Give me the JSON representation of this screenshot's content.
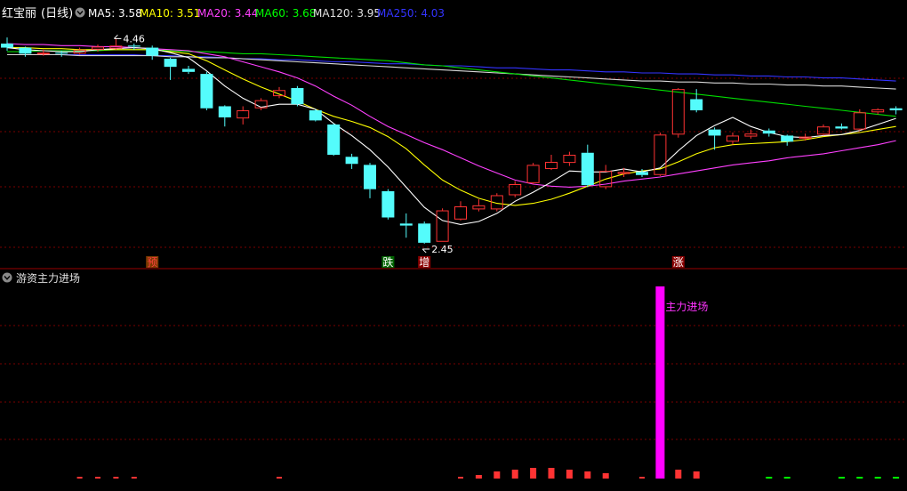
{
  "header": {
    "stock_name": "红宝丽",
    "period": "(日线)",
    "ma_items": [
      {
        "label": "MA5: 3.58",
        "color": "#ffffff"
      },
      {
        "label": "MA10: 3.51",
        "color": "#ffff00"
      },
      {
        "label": "MA20: 3.44",
        "color": "#ff40ff"
      },
      {
        "label": "MA60: 3.68",
        "color": "#00ff00"
      },
      {
        "label": "MA120: 3.95",
        "color": "#e0e0e0"
      },
      {
        "label": "MA250: 4.03",
        "color": "#3333ff"
      }
    ]
  },
  "main_panel": {
    "high_label": "4.46",
    "low_label": "2.45",
    "signals": [
      {
        "text": "预",
        "index": 8,
        "color": "#ff4040",
        "bg": "#7a3a00"
      },
      {
        "text": "跌",
        "index": 21,
        "color": "#ffffff",
        "bg": "#006400"
      },
      {
        "text": "增",
        "index": 23,
        "color": "#ffffff",
        "bg": "#8b0000"
      },
      {
        "text": "涨",
        "index": 37,
        "color": "#ffffff",
        "bg": "#8b0000"
      }
    ]
  },
  "sub_panel": {
    "title": "游资主力进场",
    "annotation": "主力进场",
    "annotation_color": "#ff33ff"
  },
  "colors": {
    "up": "#ff3333",
    "down": "#54fcfc",
    "grid": "#7a0000",
    "pink_bar": "#ff00ff",
    "green_tick": "#00ff00"
  },
  "chart_data": {
    "type": "candlestick",
    "price_range": [
      2.35,
      4.62
    ],
    "candles": [
      [
        4.4,
        4.36,
        4.46,
        4.33
      ],
      [
        4.36,
        4.3,
        4.37,
        4.27
      ],
      [
        4.3,
        4.31,
        4.34,
        4.28
      ],
      [
        4.31,
        4.3,
        4.33,
        4.27
      ],
      [
        4.3,
        4.34,
        4.36,
        4.29
      ],
      [
        4.34,
        4.37,
        4.39,
        4.32
      ],
      [
        4.35,
        4.38,
        4.45,
        4.34
      ],
      [
        4.38,
        4.37,
        4.4,
        4.34
      ],
      [
        4.36,
        4.28,
        4.38,
        4.24
      ],
      [
        4.25,
        4.17,
        4.26,
        4.04
      ],
      [
        4.15,
        4.12,
        4.18,
        4.1
      ],
      [
        4.1,
        3.76,
        4.12,
        3.74
      ],
      [
        3.78,
        3.67,
        3.79,
        3.58
      ],
      [
        3.66,
        3.74,
        3.78,
        3.6
      ],
      [
        3.76,
        3.84,
        3.86,
        3.74
      ],
      [
        3.88,
        3.94,
        3.97,
        3.86
      ],
      [
        3.96,
        3.8,
        3.98,
        3.78
      ],
      [
        3.74,
        3.64,
        3.75,
        3.63
      ],
      [
        3.6,
        3.3,
        3.61,
        3.29
      ],
      [
        3.28,
        3.21,
        3.31,
        3.16
      ],
      [
        3.2,
        2.96,
        3.22,
        2.87
      ],
      [
        2.94,
        2.68,
        2.96,
        2.66
      ],
      [
        2.62,
        2.6,
        2.72,
        2.48
      ],
      [
        2.62,
        2.43,
        2.64,
        2.42
      ],
      [
        2.44,
        2.75,
        2.77,
        2.44
      ],
      [
        2.66,
        2.79,
        2.84,
        2.65
      ],
      [
        2.76,
        2.8,
        2.86,
        2.74
      ],
      [
        2.76,
        2.9,
        2.92,
        2.74
      ],
      [
        2.9,
        3.01,
        3.04,
        2.88
      ],
      [
        3.02,
        3.2,
        3.22,
        3.01
      ],
      [
        3.16,
        3.23,
        3.3,
        3.15
      ],
      [
        3.22,
        3.3,
        3.33,
        3.19
      ],
      [
        3.32,
        3.0,
        3.4,
        2.98
      ],
      [
        2.98,
        3.14,
        3.2,
        2.96
      ],
      [
        3.11,
        3.13,
        3.17,
        3.08
      ],
      [
        3.13,
        3.1,
        3.16,
        3.08
      ],
      [
        3.1,
        3.5,
        3.52,
        3.09
      ],
      [
        3.5,
        3.95,
        3.96,
        3.47
      ],
      [
        3.85,
        3.74,
        3.95,
        3.72
      ],
      [
        3.55,
        3.49,
        3.57,
        3.35
      ],
      [
        3.43,
        3.49,
        3.52,
        3.4
      ],
      [
        3.48,
        3.51,
        3.55,
        3.46
      ],
      [
        3.54,
        3.51,
        3.56,
        3.48
      ],
      [
        3.49,
        3.43,
        3.5,
        3.39
      ],
      [
        3.46,
        3.48,
        3.51,
        3.44
      ],
      [
        3.5,
        3.58,
        3.6,
        3.49
      ],
      [
        3.58,
        3.56,
        3.61,
        3.55
      ],
      [
        3.55,
        3.72,
        3.75,
        3.54
      ],
      [
        3.72,
        3.75,
        3.76,
        3.7
      ],
      [
        3.76,
        3.74,
        3.78,
        3.7
      ]
    ],
    "ma5": [
      4.36,
      4.34,
      4.33,
      4.32,
      4.32,
      4.34,
      4.35,
      4.36,
      4.35,
      4.31,
      4.26,
      4.13,
      3.98,
      3.86,
      3.77,
      3.8,
      3.8,
      3.75,
      3.61,
      3.49,
      3.35,
      3.18,
      2.98,
      2.78,
      2.65,
      2.61,
      2.64,
      2.72,
      2.84,
      2.93,
      3.03,
      3.14,
      3.13,
      3.13,
      3.16,
      3.13,
      3.17,
      3.34,
      3.49,
      3.59,
      3.67,
      3.58,
      3.52,
      3.48,
      3.47,
      3.49,
      3.5,
      3.54,
      3.6,
      3.66
    ],
    "ma10": [
      4.36,
      4.36,
      4.35,
      4.35,
      4.34,
      4.34,
      4.34,
      4.34,
      4.34,
      4.32,
      4.3,
      4.23,
      4.14,
      4.05,
      3.97,
      3.9,
      3.83,
      3.75,
      3.68,
      3.63,
      3.57,
      3.48,
      3.36,
      3.2,
      3.05,
      2.95,
      2.87,
      2.82,
      2.8,
      2.82,
      2.86,
      2.92,
      2.99,
      3.06,
      3.11,
      3.14,
      3.16,
      3.23,
      3.31,
      3.37,
      3.4,
      3.41,
      3.42,
      3.43,
      3.45,
      3.48,
      3.5,
      3.52,
      3.55,
      3.58
    ],
    "ma20": [
      4.4,
      4.39,
      4.39,
      4.38,
      4.38,
      4.37,
      4.37,
      4.36,
      4.35,
      4.34,
      4.33,
      4.3,
      4.27,
      4.22,
      4.17,
      4.12,
      4.06,
      3.98,
      3.88,
      3.79,
      3.68,
      3.58,
      3.5,
      3.42,
      3.35,
      3.27,
      3.19,
      3.12,
      3.05,
      3.01,
      2.99,
      2.98,
      2.99,
      3.01,
      3.04,
      3.06,
      3.08,
      3.11,
      3.14,
      3.17,
      3.2,
      3.22,
      3.24,
      3.27,
      3.29,
      3.31,
      3.34,
      3.37,
      3.4,
      3.44
    ],
    "ma60": [
      4.32,
      4.32,
      4.33,
      4.33,
      4.33,
      4.33,
      4.34,
      4.34,
      4.34,
      4.33,
      4.32,
      4.32,
      4.31,
      4.3,
      4.3,
      4.29,
      4.28,
      4.27,
      4.26,
      4.25,
      4.24,
      4.23,
      4.21,
      4.19,
      4.18,
      4.16,
      4.14,
      4.12,
      4.1,
      4.08,
      4.06,
      4.04,
      4.02,
      4.0,
      3.98,
      3.96,
      3.94,
      3.92,
      3.9,
      3.88,
      3.86,
      3.84,
      3.82,
      3.8,
      3.78,
      3.76,
      3.74,
      3.72,
      3.7,
      3.68
    ],
    "ma120": [
      4.29,
      4.29,
      4.29,
      4.29,
      4.28,
      4.28,
      4.28,
      4.28,
      4.28,
      4.27,
      4.27,
      4.26,
      4.26,
      4.25,
      4.24,
      4.23,
      4.22,
      4.21,
      4.2,
      4.19,
      4.18,
      4.17,
      4.16,
      4.15,
      4.14,
      4.13,
      4.12,
      4.11,
      4.1,
      4.09,
      4.08,
      4.07,
      4.06,
      4.05,
      4.04,
      4.03,
      4.03,
      4.02,
      4.02,
      4.01,
      4.01,
      4.0,
      4.0,
      3.99,
      3.99,
      3.98,
      3.98,
      3.97,
      3.96,
      3.95
    ],
    "ma250": [
      4.29,
      4.29,
      4.29,
      4.29,
      4.29,
      4.29,
      4.29,
      4.29,
      4.28,
      4.28,
      4.27,
      4.27,
      4.26,
      4.25,
      4.25,
      4.24,
      4.24,
      4.23,
      4.22,
      4.22,
      4.21,
      4.2,
      4.2,
      4.19,
      4.18,
      4.18,
      4.17,
      4.16,
      4.16,
      4.15,
      4.14,
      4.14,
      4.13,
      4.12,
      4.12,
      4.11,
      4.11,
      4.1,
      4.1,
      4.09,
      4.09,
      4.08,
      4.08,
      4.07,
      4.07,
      4.06,
      4.06,
      4.05,
      4.04,
      4.03
    ],
    "sub_range": [
      0,
      100
    ],
    "sub_bars": [
      0,
      0,
      0,
      0,
      1,
      1,
      1,
      1,
      0,
      0,
      0,
      0,
      0,
      0,
      0,
      1,
      0,
      0,
      0,
      0,
      0,
      0,
      0,
      0,
      0,
      1,
      2,
      4,
      5,
      6,
      6,
      5,
      4,
      3,
      0,
      1,
      100,
      5,
      4,
      0,
      0,
      0,
      -1,
      -1,
      0,
      0,
      -0.6,
      -0.6,
      -0.6,
      -0.6
    ]
  }
}
